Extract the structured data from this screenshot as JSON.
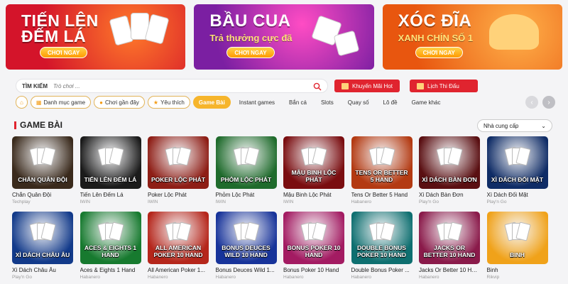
{
  "banners": [
    {
      "title_line1": "TIẾN LÊN",
      "title_line2": "ĐẾM LÁ",
      "button": "CHƠI NGAY",
      "bg": "#d4142a"
    },
    {
      "title_line1": "BẦU CUA",
      "subtitle": "Trả thưởng cực đã",
      "button": "CHƠI NGAY",
      "bg": "#7b1fa2"
    },
    {
      "title_line1": "XÓC ĐĨA",
      "subtitle": "XANH CHÍN SỐ 1",
      "button": "CHƠI NGAY",
      "bg": "#e8560f"
    }
  ],
  "search": {
    "label": "TÌM KIẾM",
    "placeholder": "Trò chơi ..."
  },
  "promos": {
    "hot": "Khuyến Mãi Hot",
    "schedule": "Lịch Thi Đấu"
  },
  "categories": [
    "Danh mục game",
    "Chơi gần đây",
    "Yêu thích",
    "Game Bài",
    "Instant games",
    "Bắn cá",
    "Slots",
    "Quay số",
    "Lô đề",
    "Game khác"
  ],
  "section": {
    "title": "GAME BÀI",
    "provider_select": "Nhà cung cấp"
  },
  "games": [
    {
      "thumb": "CHẮN QUÂN ĐỘI",
      "name": "Chắn Quân Đội",
      "provider": "Techplay",
      "bg": "#3a2a1c"
    },
    {
      "thumb": "TIẾN LÊN ĐẾM LÁ",
      "name": "Tiến Lên Đếm Lá",
      "provider": "IWIN",
      "bg": "#1b1b1b"
    },
    {
      "thumb": "POKER LỘC PHÁT",
      "name": "Poker Lộc Phát",
      "provider": "IWIN",
      "bg": "#8e1e16"
    },
    {
      "thumb": "PHỎM LỘC PHÁT",
      "name": "Phỏm Lộc Phát",
      "provider": "IWIN",
      "bg": "#1f6b2c"
    },
    {
      "thumb": "MẬU BINH LỘC PHÁT",
      "name": "Mậu Binh Lộc Phát",
      "provider": "IWIN",
      "bg": "#7a0d10"
    },
    {
      "thumb": "TENS OR BETTER 5 HAND",
      "name": "Tens Or Better 5 Hand",
      "provider": "Habanero",
      "bg": "#b33a12"
    },
    {
      "thumb": "XÌ DÁCH BÀN ĐƠN",
      "name": "Xì Dách Bàn Đơn",
      "provider": "Play'n Go",
      "bg": "#5a0f12"
    },
    {
      "thumb": "XÌ DÁCH ĐỐI MẶT",
      "name": "Xì Dách Đối Mặt",
      "provider": "Play'n Go",
      "bg": "#0f2c66"
    },
    {
      "thumb": "XÌ DÁCH CHÂU ÂU",
      "name": "Xì Dách Châu Âu",
      "provider": "Play'n Go",
      "bg": "#123a8a"
    },
    {
      "thumb": "ACES & EIGHTS 1 HAND",
      "name": "Aces & Eights 1 Hand",
      "provider": "Habanero",
      "bg": "#177a2f"
    },
    {
      "thumb": "ALL AMERICAN POKER 10 HAND",
      "name": "All American Poker 1...",
      "provider": "Habanero",
      "bg": "#b5261b"
    },
    {
      "thumb": "BONUS DEUCES WILD 10 HAND",
      "name": "Bonus Deuces Wild 1...",
      "provider": "Habanero",
      "bg": "#17339a"
    },
    {
      "thumb": "BONUS POKER 10 HAND",
      "name": "Bonus Poker 10 Hand",
      "provider": "Habanero",
      "bg": "#a31b62"
    },
    {
      "thumb": "DOUBLE BONUS POKER 10 HAND",
      "name": "Double Bonus Poker ...",
      "provider": "Habanero",
      "bg": "#0e6f70"
    },
    {
      "thumb": "JACKS OR BETTER 10 HAND",
      "name": "Jacks Or Better 10 Hand",
      "provider": "Habanero",
      "bg": "#8a1a4a"
    },
    {
      "thumb": "BINH",
      "name": "Binh",
      "provider": "Rikvip",
      "bg": "#f0a21a"
    }
  ],
  "colors": {
    "accent": "#e0242f",
    "active_pill": "#f6b52c"
  }
}
